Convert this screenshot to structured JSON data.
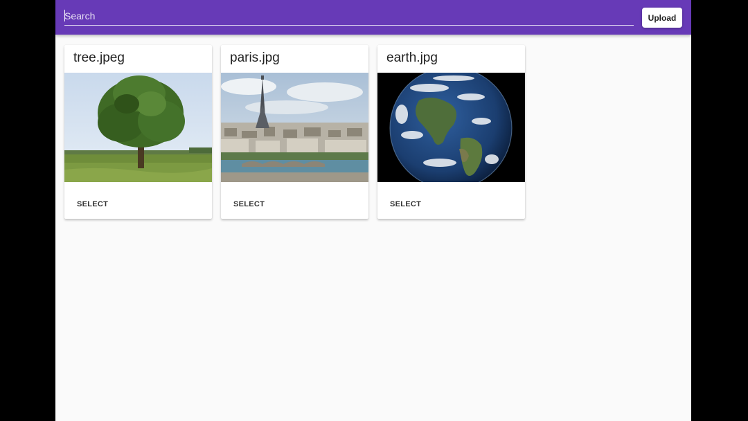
{
  "toolbar": {
    "search_placeholder": "Search",
    "upload_label": "Upload",
    "color": "#673ab7"
  },
  "cards": [
    {
      "title": "tree.jpeg",
      "image": "tree-photo",
      "action_label": "SELECT"
    },
    {
      "title": "paris.jpg",
      "image": "paris-photo",
      "action_label": "SELECT"
    },
    {
      "title": "earth.jpg",
      "image": "earth-photo",
      "action_label": "SELECT"
    }
  ]
}
